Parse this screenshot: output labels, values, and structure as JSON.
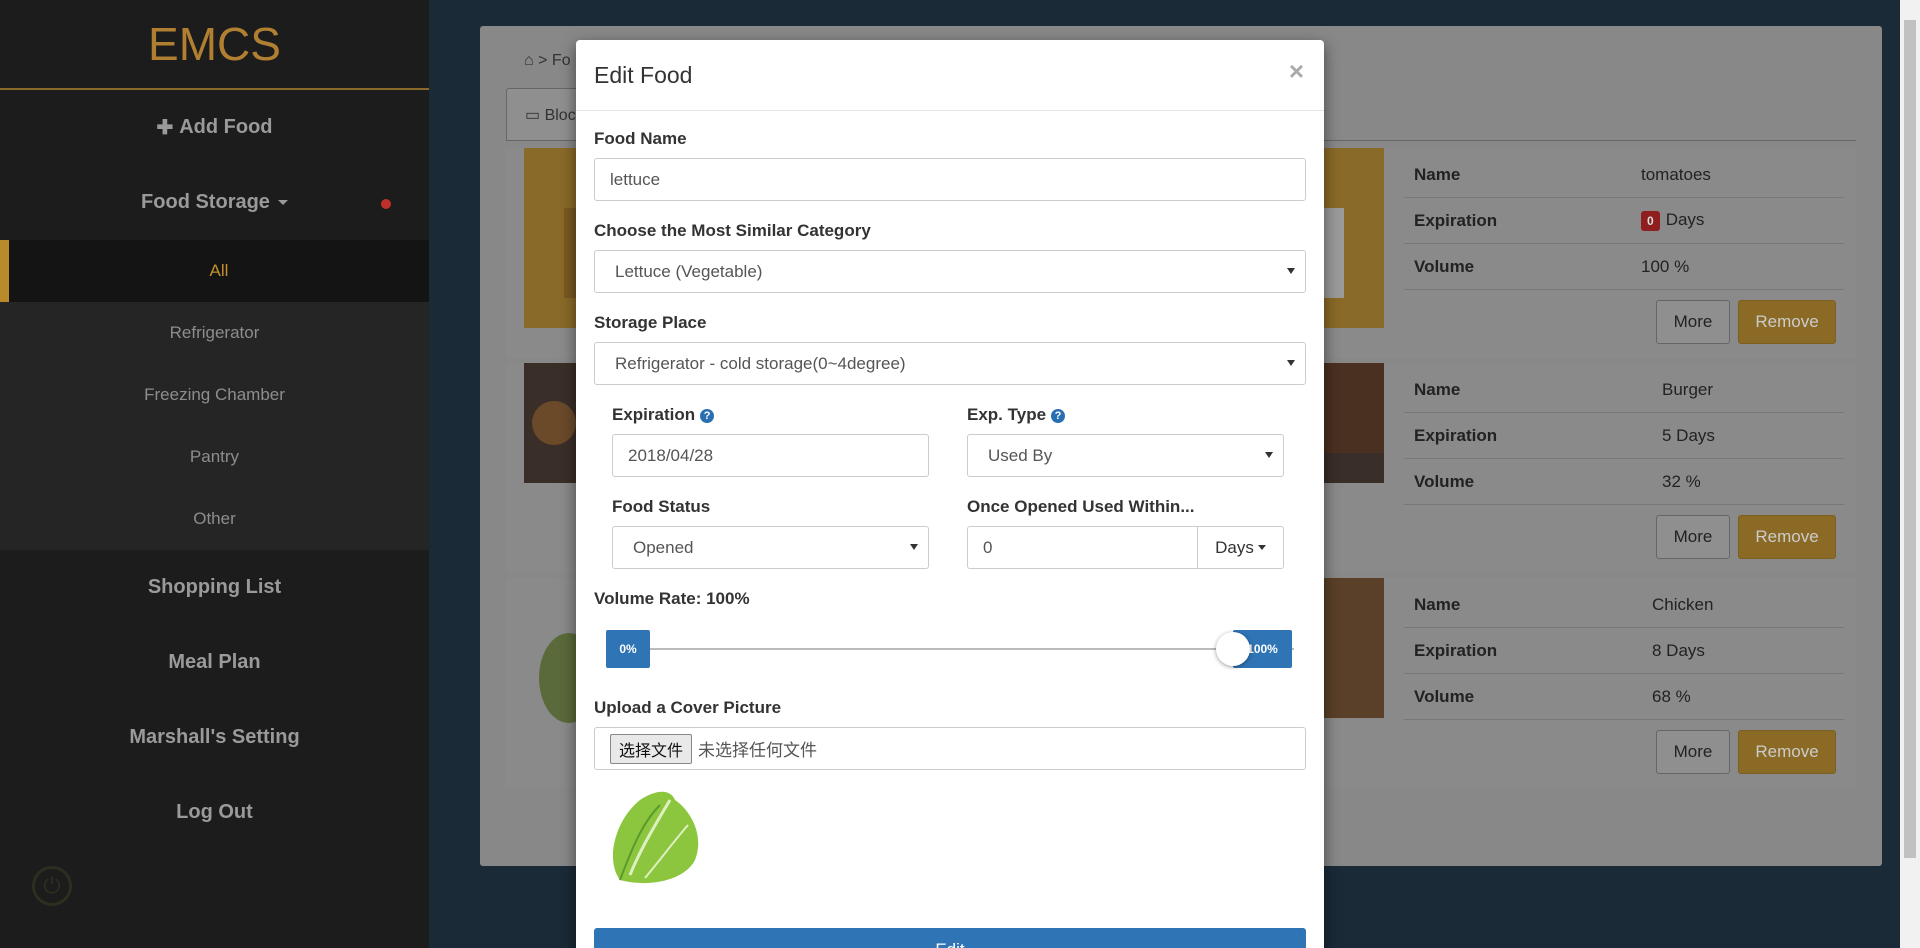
{
  "sidebar": {
    "brand": "EMCS",
    "add_food": "Add Food",
    "food_storage": "Food Storage",
    "sub_items": [
      "All",
      "Refrigerator",
      "Freezing Chamber",
      "Pantry",
      "Other"
    ],
    "shopping_list": "Shopping List",
    "meal_plan": "Meal Plan",
    "setting": "Marshall's Setting",
    "logout": "Log Out"
  },
  "background": {
    "breadcrumb": "> Fo",
    "tab": "Bloc",
    "cards": [
      {
        "name_label": "Name",
        "name": "tomatoes",
        "exp_label": "Expiration",
        "exp_badge": "0",
        "exp_value": "Days",
        "vol_label": "Volume",
        "volume": "100 %",
        "more": "More",
        "remove": "Remove"
      },
      {
        "name_label": "Name",
        "name": "Burger",
        "exp_label": "Expiration",
        "exp_value": "5 Days",
        "vol_label": "Volume",
        "volume": "32 %",
        "more": "More",
        "remove": "Remove"
      },
      {
        "name_label": "Name",
        "name": "Chicken",
        "exp_label": "Expiration",
        "exp_value": "8 Days",
        "vol_label": "Volume",
        "volume": "68 %",
        "more": "More",
        "remove": "Remove"
      }
    ]
  },
  "modal": {
    "title": "Edit Food",
    "close": "×",
    "food_name_label": "Food Name",
    "food_name_value": "lettuce",
    "category_label": "Choose the Most Similar Category",
    "category_value": "Lettuce (Vegetable)",
    "storage_label": "Storage Place",
    "storage_value": "Refrigerator - cold storage(0~4degree)",
    "expiration_label": "Expiration",
    "expiration_value": "2018/04/28",
    "exp_type_label": "Exp. Type",
    "exp_type_value": "Used By",
    "status_label": "Food Status",
    "status_value": "Opened",
    "once_opened_label": "Once Opened Used Within...",
    "once_opened_value": "0",
    "once_opened_unit": "Days",
    "volume_label": "Volume Rate: 100%",
    "volume_rate": 1.0,
    "slider_min": "0%",
    "slider_max": "100%",
    "upload_label": "Upload a Cover Picture",
    "file_button": "选择文件",
    "file_status": "未选择任何文件",
    "submit": "Edit"
  },
  "colors": {
    "accent": "#b07f31",
    "primary": "#2f74b5",
    "danger": "#8f1f1f"
  }
}
